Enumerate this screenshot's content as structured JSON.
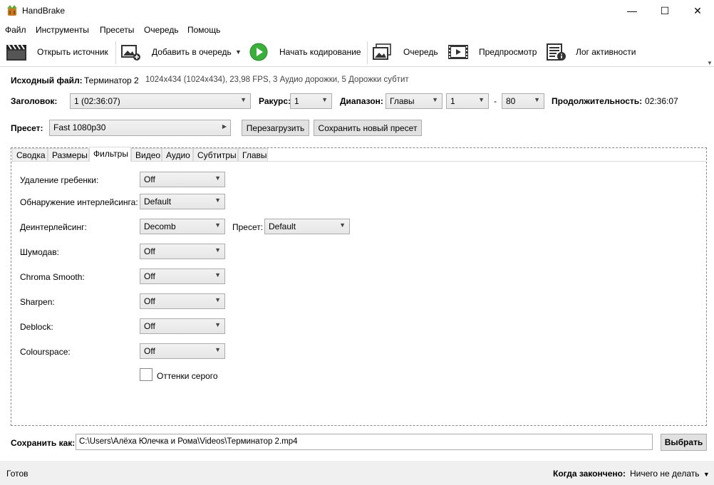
{
  "window": {
    "title": "HandBrake",
    "controls": {
      "minimize": "—",
      "maximize": "☐",
      "close": "✕"
    }
  },
  "menu": [
    "Файл",
    "Инструменты",
    "Пресеты",
    "Очередь",
    "Помощь"
  ],
  "toolbar": {
    "open_source": "Открыть источник",
    "add_to_queue": "Добавить в очередь",
    "start_encode": "Начать кодирование",
    "queue": "Очередь",
    "preview": "Предпросмотр",
    "activity_log": "Лог активности"
  },
  "source": {
    "label": "Исходный файл:",
    "name": "Терминатор 2",
    "info": "1024x434 (1024x434), 23,98 FPS, 3 Аудио дорожки, 5 Дорожки субтит"
  },
  "title_row": {
    "title_label": "Заголовок:",
    "title_value": "1 (02:36:07)",
    "angle_label": "Ракурс:",
    "angle_value": "1",
    "range_label": "Диапазон:",
    "range_type": "Главы",
    "range_from": "1",
    "range_dash": "-",
    "range_to": "80",
    "duration_label": "Продолжительность:",
    "duration_value": "02:36:07"
  },
  "preset": {
    "label": "Пресет:",
    "value": "Fast 1080p30",
    "reload": "Перезагрузить",
    "save_new": "Сохранить новый пресет"
  },
  "tabs": [
    "Сводка",
    "Размеры",
    "Фильтры",
    "Видео",
    "Аудио",
    "Субтитры",
    "Главы"
  ],
  "active_tab": "Фильтры",
  "filters": {
    "detelecine": {
      "label": "Удаление гребенки:",
      "value": "Off"
    },
    "interlace_detect": {
      "label": "Обнаружение интерлейсинга:",
      "value": "Default"
    },
    "deinterlace": {
      "label": "Деинтерлейсинг:",
      "value": "Decomb",
      "preset_label": "Пресет:",
      "preset_value": "Default"
    },
    "denoise": {
      "label": "Шумодав:",
      "value": "Off"
    },
    "chroma_smooth": {
      "label": "Chroma Smooth:",
      "value": "Off"
    },
    "sharpen": {
      "label": "Sharpen:",
      "value": "Off"
    },
    "deblock": {
      "label": "Deblock:",
      "value": "Off"
    },
    "colourspace": {
      "label": "Colourspace:",
      "value": "Off"
    },
    "grayscale": {
      "label": "Оттенки серого",
      "checked": false
    }
  },
  "save_as": {
    "label": "Сохранить как:",
    "path": "C:\\Users\\Алёха Юлечка и Рома\\Videos\\Терминатор 2.mp4",
    "browse": "Выбрать"
  },
  "status": {
    "text": "Готов",
    "when_done_label": "Когда закончено:",
    "when_done_value": "Ничего не делать"
  },
  "icons": {
    "open_source": "clapperboard-icon",
    "add_to_queue": "add-queue-icon",
    "start_encode": "play-icon",
    "queue": "queue-icon",
    "preview": "film-preview-icon",
    "activity_log": "log-icon"
  },
  "colors": {
    "play_green": "#3cae3c",
    "panel_bg": "#f0f0f0"
  }
}
